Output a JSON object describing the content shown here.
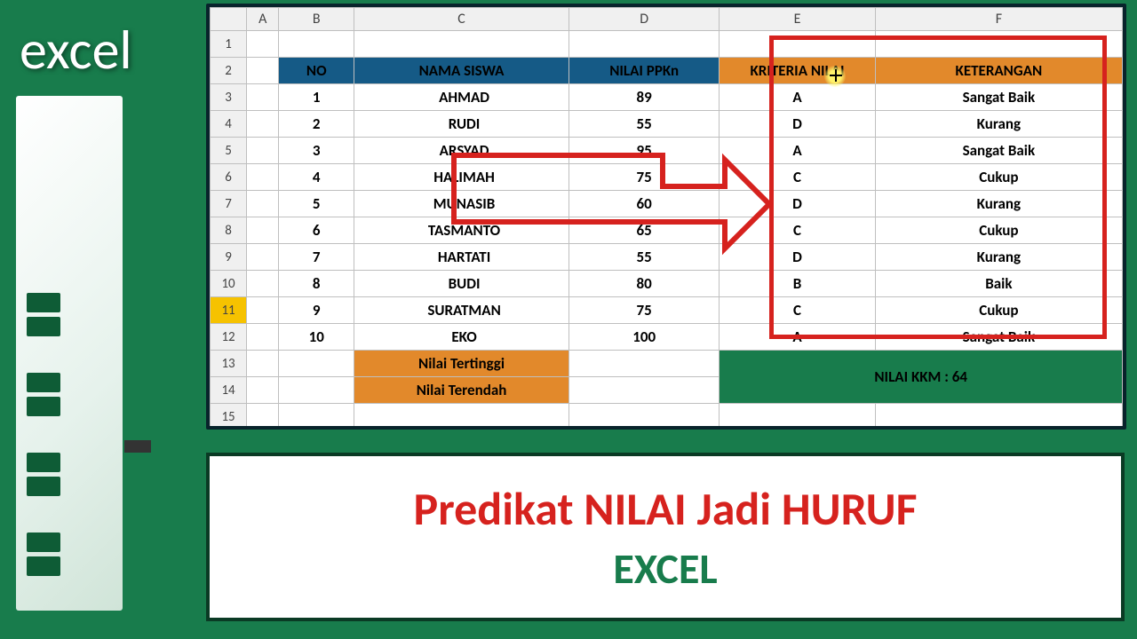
{
  "brand": "excel",
  "columns": [
    "",
    "A",
    "B",
    "C",
    "D",
    "E",
    "F"
  ],
  "rows": [
    "1",
    "2",
    "3",
    "4",
    "5",
    "6",
    "7",
    "8",
    "9",
    "10",
    "11",
    "12",
    "13",
    "14",
    "15"
  ],
  "selectedRow": "11",
  "headers": {
    "no": "NO",
    "nama": "NAMA SISWA",
    "nilai": "NILAI PPKn",
    "kriteria": "KRITERIA NILAI",
    "ket": "KETERANGAN"
  },
  "students": [
    {
      "no": "1",
      "nama": "AHMAD",
      "nilai": "89",
      "krit": "A",
      "ket": "Sangat Baik"
    },
    {
      "no": "2",
      "nama": "RUDI",
      "nilai": "55",
      "krit": "D",
      "ket": "Kurang"
    },
    {
      "no": "3",
      "nama": "ARSYAD",
      "nilai": "95",
      "krit": "A",
      "ket": "Sangat Baik"
    },
    {
      "no": "4",
      "nama": "HALIMAH",
      "nilai": "75",
      "krit": "C",
      "ket": "Cukup"
    },
    {
      "no": "5",
      "nama": "MUNASIB",
      "nilai": "60",
      "krit": "D",
      "ket": "Kurang"
    },
    {
      "no": "6",
      "nama": "TASMANTO",
      "nilai": "65",
      "krit": "C",
      "ket": "Cukup"
    },
    {
      "no": "7",
      "nama": "HARTATI",
      "nilai": "55",
      "krit": "D",
      "ket": "Kurang"
    },
    {
      "no": "8",
      "nama": "BUDI",
      "nilai": "80",
      "krit": "B",
      "ket": "Baik"
    },
    {
      "no": "9",
      "nama": "SURATMAN",
      "nilai": "75",
      "krit": "C",
      "ket": "Cukup"
    },
    {
      "no": "10",
      "nama": "EKO",
      "nilai": "100",
      "krit": "A",
      "ket": "Sangat Baik"
    }
  ],
  "footer": {
    "tertinggi": "Nilai Tertinggi",
    "terendah": "Nilai Terendah",
    "kkm": "NILAI KKM : 64"
  },
  "title": {
    "line1": "Predikat NILAI Jadi HURUF",
    "line2": "EXCEL"
  }
}
